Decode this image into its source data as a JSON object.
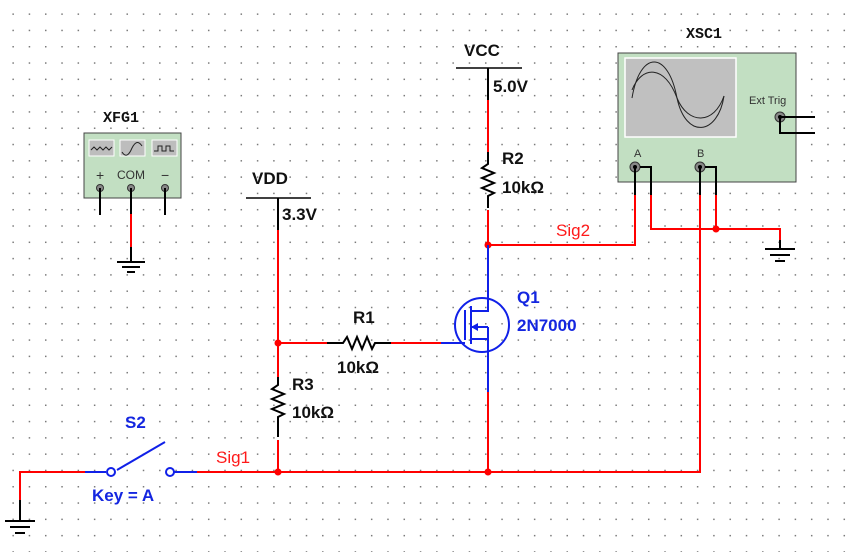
{
  "colors": {
    "wire": "#ff0000",
    "component": "#000000",
    "switch_mosfet": "#1426e0",
    "instrument_body": "#c2dfc2",
    "screen": "#c0c0c0"
  },
  "instruments": {
    "function_generator": {
      "name": "XFG1",
      "waveforms": [
        "sine",
        "triangle",
        "square"
      ],
      "terminals": [
        "+",
        "COM",
        "−"
      ]
    },
    "oscilloscope": {
      "name": "XSC1",
      "channel_a": "A",
      "channel_b": "B",
      "ext_trig": "Ext Trig",
      "plus": "+",
      "minus": "−"
    }
  },
  "supplies": {
    "vcc": {
      "name": "VCC",
      "value": "5.0V"
    },
    "vdd": {
      "name": "VDD",
      "value": "3.3V"
    }
  },
  "components": {
    "r1": {
      "name": "R1",
      "value": "10kΩ"
    },
    "r2": {
      "name": "R2",
      "value": "10kΩ"
    },
    "r3": {
      "name": "R3",
      "value": "10kΩ"
    },
    "q1": {
      "name": "Q1",
      "model": "2N7000"
    },
    "s2": {
      "name": "S2",
      "key": "Key = A"
    }
  },
  "nets": {
    "sig1": "Sig1",
    "sig2": "Sig2"
  }
}
